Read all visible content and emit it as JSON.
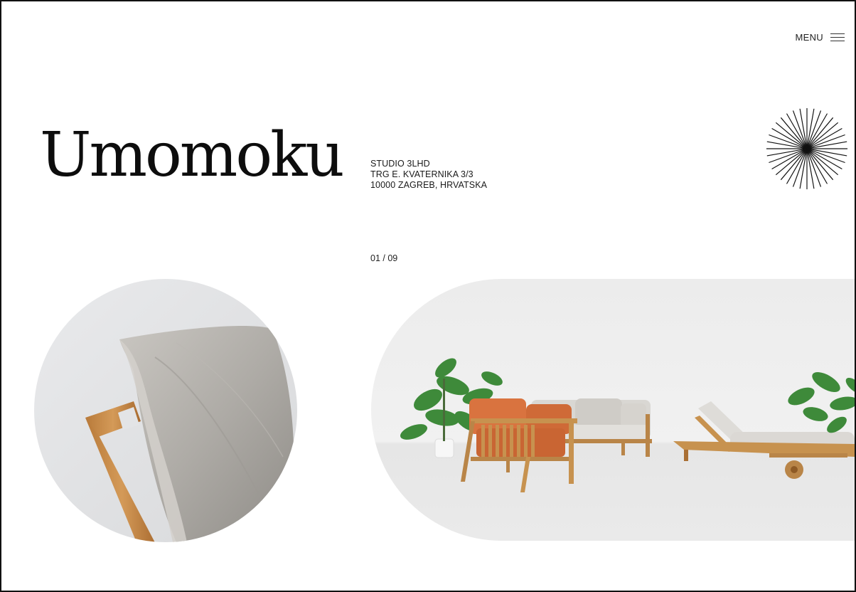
{
  "header": {
    "menu_label": "MENU"
  },
  "hero": {
    "logo_text": "Umomoku",
    "address": {
      "line1": "STUDIO 3LHD",
      "line2": "TRG E. KVATERNIKA 3/3",
      "line3": "10000 ZAGREB, HRVATSKA"
    },
    "slide_counter": "01 / 09"
  },
  "icons": {
    "menu": "hamburger-icon",
    "burst": "sunburst-icon"
  },
  "colors": {
    "text": "#111111",
    "background": "#ffffff",
    "cushion_orange": "#d9733f",
    "teak": "#c7924f"
  }
}
